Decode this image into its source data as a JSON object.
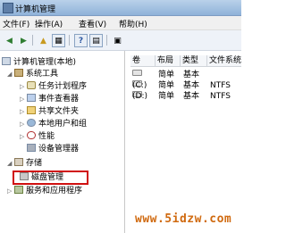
{
  "window": {
    "title": "计算机管理"
  },
  "menu": {
    "items": [
      "文件(F)",
      "操作(A)",
      "查看(V)",
      "帮助(H)"
    ]
  },
  "toolbar": {
    "buttons": [
      "back-arrow-icon",
      "forward-arrow-icon",
      "folder-up-icon",
      "show-hide-tree-icon",
      "help-icon",
      "properties-icon"
    ]
  },
  "tree": {
    "root": "计算机管理(本地)",
    "system_tools": "系统工具",
    "task_scheduler": "任务计划程序",
    "event_viewer": "事件查看器",
    "shared_folders": "共享文件夹",
    "local_users": "本地用户和组",
    "performance": "性能",
    "device_manager": "设备管理器",
    "storage": "存储",
    "disk_management": "磁盘管理",
    "services_apps": "服务和应用程序"
  },
  "volume_list": {
    "columns": [
      "卷",
      "布局",
      "类型",
      "文件系统"
    ],
    "rows": [
      {
        "volume": "",
        "layout": "简单",
        "type": "基本",
        "fs": ""
      },
      {
        "volume": "(C:)",
        "layout": "简单",
        "type": "基本",
        "fs": "NTFS"
      },
      {
        "volume": "(D:)",
        "layout": "简单",
        "type": "基本",
        "fs": "NTFS"
      }
    ]
  },
  "watermark": "www.5idzw.com",
  "colors": {
    "highlight": "#d01010",
    "watermark": "#d06a10"
  }
}
